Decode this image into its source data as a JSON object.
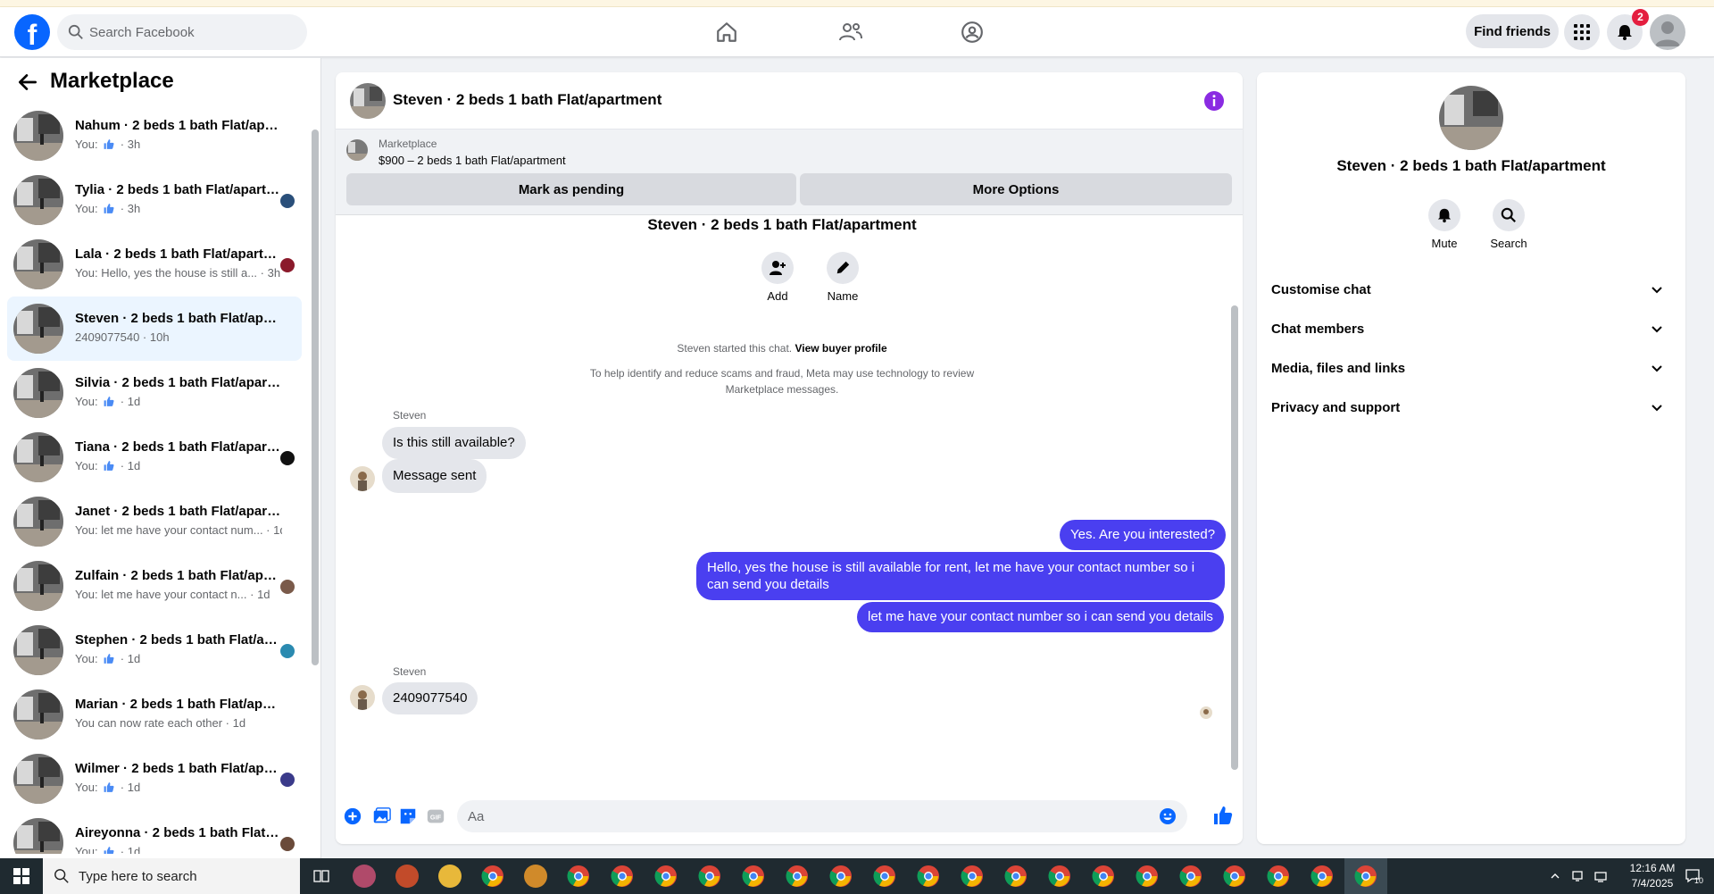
{
  "header": {
    "logo_letter": "f",
    "search_placeholder": "Search Facebook",
    "find_friends_label": "Find friends",
    "notifications_count": "2"
  },
  "sidebar": {
    "back_label": "",
    "title": "Marketplace",
    "conversations": [
      {
        "name": "Nahum · 2 beds 1 bath Flat/apartment",
        "snippet_prefix": "You:",
        "snippet_text": "",
        "like": true,
        "time": "3h",
        "active": false,
        "seen_color": ""
      },
      {
        "name": "Tylia · 2 beds 1 bath Flat/apartment",
        "snippet_prefix": "You:",
        "snippet_text": "",
        "like": true,
        "time": "3h",
        "active": false,
        "seen_color": "#2a4f7a"
      },
      {
        "name": "Lala · 2 beds 1 bath Flat/apartment",
        "snippet_prefix": "You:",
        "snippet_text": "Hello, yes the house is still a...",
        "like": false,
        "time": "3h",
        "active": false,
        "seen_color": "#8b1a2b"
      },
      {
        "name": "Steven · 2 beds 1 bath Flat/apartment",
        "snippet_prefix": "",
        "snippet_text": "2409077540",
        "like": false,
        "time": "10h",
        "active": true,
        "seen_color": ""
      },
      {
        "name": "Silvia · 2 beds 1 bath Flat/apartment",
        "snippet_prefix": "You:",
        "snippet_text": "",
        "like": true,
        "time": "1d",
        "active": false,
        "seen_color": ""
      },
      {
        "name": "Tiana · 2 beds 1 bath Flat/apartment",
        "snippet_prefix": "You:",
        "snippet_text": "",
        "like": true,
        "time": "1d",
        "active": false,
        "seen_color": "#111111"
      },
      {
        "name": "Janet · 2 beds 1 bath Flat/apartment",
        "snippet_prefix": "You:",
        "snippet_text": "let me have your contact num...",
        "like": false,
        "time": "1d",
        "active": false,
        "seen_color": ""
      },
      {
        "name": "Zulfain · 2 beds 1 bath Flat/apartment",
        "snippet_prefix": "You:",
        "snippet_text": "let me have your contact n...",
        "like": false,
        "time": "1d",
        "active": false,
        "seen_color": "#7a5a4a"
      },
      {
        "name": "Stephen · 2 beds 1 bath Flat/apartment",
        "snippet_prefix": "You:",
        "snippet_text": "",
        "like": true,
        "time": "1d",
        "active": false,
        "seen_color": "#2a8ab0"
      },
      {
        "name": "Marian · 2 beds 1 bath Flat/apartment",
        "snippet_prefix": "",
        "snippet_text": "You can now rate each other",
        "like": false,
        "time": "1d",
        "active": false,
        "seen_color": ""
      },
      {
        "name": "Wilmer · 2 beds 1 bath Flat/apartment",
        "snippet_prefix": "You:",
        "snippet_text": "",
        "like": true,
        "time": "1d",
        "active": false,
        "seen_color": "#3a3a8a"
      },
      {
        "name": "Aireyonna · 2 beds 1 bath Flat/apartment",
        "snippet_prefix": "You:",
        "snippet_text": "",
        "like": true,
        "time": "1d",
        "active": false,
        "seen_color": "#6a4a3a"
      }
    ]
  },
  "chat": {
    "title": "Steven · 2 beds 1 bath Flat/apartment",
    "listing": {
      "source": "Marketplace",
      "description": "$900 – 2 beds 1 bath Flat/apartment",
      "pending_label": "Mark as pending",
      "more_label": "More Options"
    },
    "thread_title": "Steven · 2 beds 1 bath Flat/apartment",
    "add_label": "Add",
    "name_label": "Name",
    "started_text": "Steven started this chat.",
    "view_buyer_label": "View buyer profile",
    "notice_line1": "To help identify and reduce scams and fraud, Meta may use technology to review",
    "notice_line2": "Marketplace messages.",
    "sender_name": "Steven",
    "incoming_1": "Is this still available?",
    "incoming_2": "Message sent",
    "outgoing_1": "Yes. Are you interested?",
    "outgoing_2": "Hello, yes the house is still available for rent, let me have your contact number so i can send you details",
    "outgoing_3": "let me have your contact number so i can send you details",
    "sender_name_2": "Steven",
    "incoming_3": "2409077540",
    "composer_placeholder": "Aa"
  },
  "details": {
    "name": "Steven · 2 beds 1 bath Flat/apartment",
    "mute_label": "Mute",
    "search_label": "Search",
    "sections": [
      "Customise chat",
      "Chat members",
      "Media, files and links",
      "Privacy and support"
    ]
  },
  "taskbar": {
    "search_placeholder": "Type here to search",
    "time": "12:16 AM",
    "date": "7/4/2025",
    "notif_count": "10"
  },
  "colors": {
    "brand": "#0866ff",
    "outgoing_bubble": "#4a3ff0",
    "info_icon": "#8a2be2",
    "badge": "#e41e3f"
  },
  "icons": [
    "search-icon",
    "home-icon",
    "friends-icon",
    "groups-icon",
    "grid-icon",
    "bell-icon",
    "back-arrow-icon",
    "info-icon",
    "add-person-icon",
    "pencil-icon",
    "plus-icon",
    "image-icon",
    "sticker-icon",
    "gif-icon",
    "emoji-icon",
    "like-icon",
    "chevron-down-icon"
  ]
}
